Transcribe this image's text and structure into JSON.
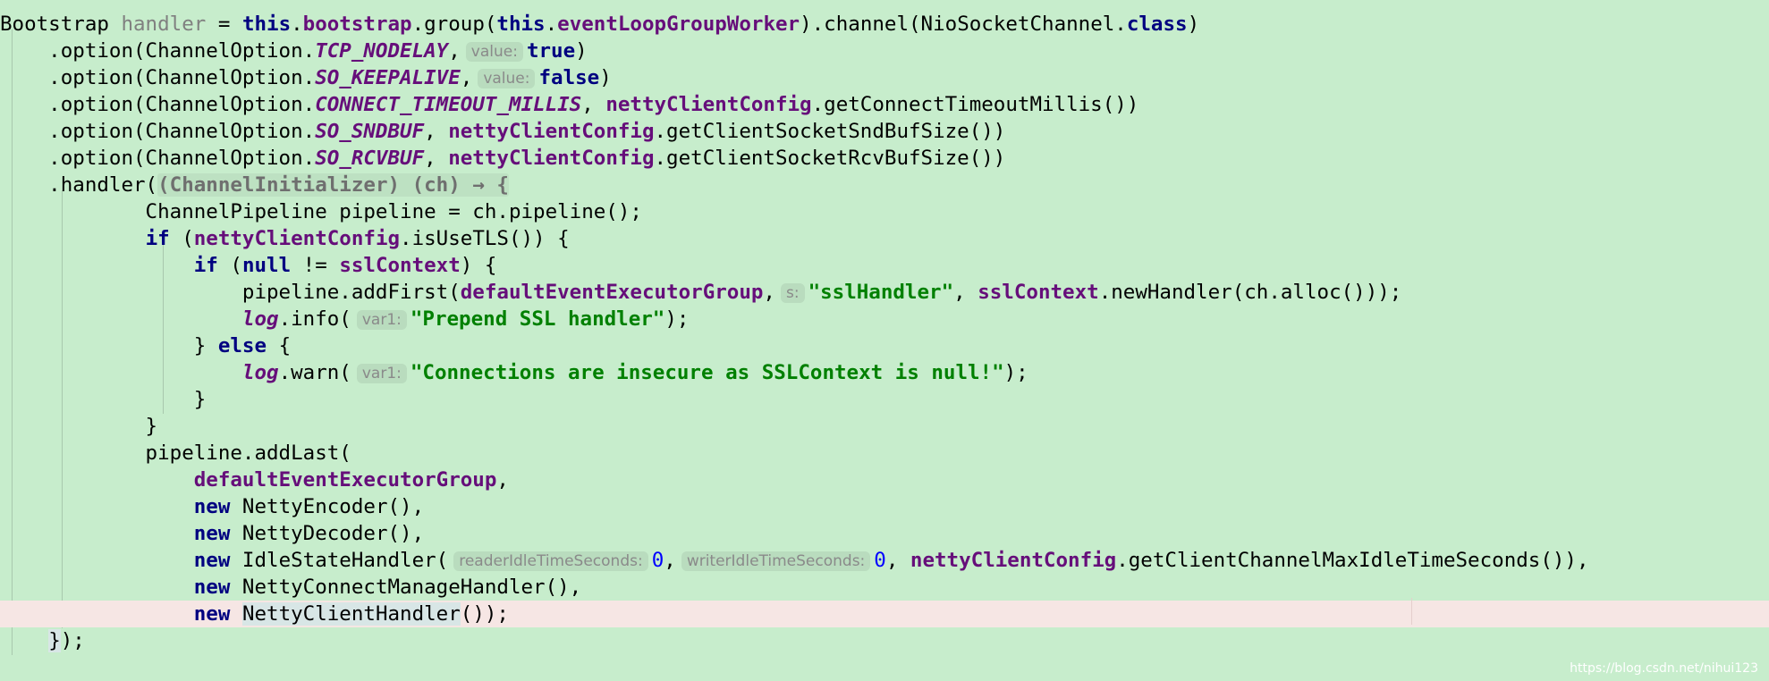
{
  "editor": {
    "theme": {
      "background": "#c7edcc",
      "highlight_line": "#f6e6e4",
      "keyword": "#000080",
      "field": "#660e7a",
      "string": "#008000",
      "number": "#0000ff",
      "hint": "#8a8a8a"
    },
    "code": {
      "l1": {
        "type": "Bootstrap ",
        "var": "handler",
        "assign": " = ",
        "this1": "this",
        "dot1": ".",
        "bootstrap": "bootstrap",
        "group_open": ".group(",
        "this2": "this",
        "dot2": ".",
        "worker": "eventLoopGroupWorker",
        "channel_call": ").channel(NioSocketChannel.",
        "class_kw": "class",
        "close": ")"
      },
      "l2": {
        "prefix": "    .option(ChannelOption.",
        "const": "TCP_NODELAY",
        "comma": ",",
        "hint": "value:",
        "value": "true",
        "close": ")"
      },
      "l3": {
        "prefix": "    .option(ChannelOption.",
        "const": "SO_KEEPALIVE",
        "comma": ",",
        "hint": "value:",
        "value": "false",
        "close": ")"
      },
      "l4": {
        "prefix": "    .option(ChannelOption.",
        "const": "CONNECT_TIMEOUT_MILLIS",
        "comma": ", ",
        "config": "nettyClientConfig",
        "call": ".getConnectTimeoutMillis())"
      },
      "l5": {
        "prefix": "    .option(ChannelOption.",
        "const": "SO_SNDBUF",
        "comma": ", ",
        "config": "nettyClientConfig",
        "call": ".getClientSocketSndBufSize())"
      },
      "l6": {
        "prefix": "    .option(ChannelOption.",
        "const": "SO_RCVBUF",
        "comma": ", ",
        "config": "nettyClientConfig",
        "call": ".getClientSocketRcvBufSize())"
      },
      "l7": {
        "prefix": "    .handler(",
        "lambda": "(ChannelInitializer) (ch) → {"
      },
      "l8": {
        "text": "            ChannelPipeline pipeline = ch.pipeline();"
      },
      "l9": {
        "indent": "            ",
        "if_kw": "if",
        "open": " (",
        "config": "nettyClientConfig",
        "rest": ".isUseTLS()) {"
      },
      "l10": {
        "indent": "                ",
        "if_kw": "if",
        "open": " (",
        "null_kw": "null",
        "neq": " != ",
        "ssl": "sslContext",
        "rest": ") {"
      },
      "l11": {
        "prefix": "                    pipeline.addFirst(",
        "group": "defaultEventExecutorGroup",
        "comma": ",",
        "hint": "s:",
        "str": "\"sslHandler\"",
        "comma2": ", ",
        "ssl": "sslContext",
        "rest": ".newHandler(ch.alloc()));"
      },
      "l12": {
        "indent": "                    ",
        "log": "log",
        "call": ".info(",
        "hint": "var1:",
        "str": "\"Prepend SSL handler\"",
        "close": ");"
      },
      "l13": {
        "prefix": "                } ",
        "else_kw": "else",
        "rest": " {"
      },
      "l14": {
        "indent": "                    ",
        "log": "log",
        "call": ".warn(",
        "hint": "var1:",
        "str": "\"Connections are insecure as SSLContext is null!\"",
        "close": ");"
      },
      "l15": {
        "text": "                }"
      },
      "l16": {
        "text": "            }"
      },
      "l17": {
        "text": "            pipeline.addLast("
      },
      "l18": {
        "indent": "                ",
        "group": "defaultEventExecutorGroup",
        "comma": ","
      },
      "l19": {
        "indent": "                ",
        "new_kw": "new",
        "rest": " NettyEncoder(),"
      },
      "l20": {
        "indent": "                ",
        "new_kw": "new",
        "rest": " NettyDecoder(),"
      },
      "l21": {
        "indent": "                ",
        "new_kw": "new",
        "call": " IdleStateHandler(",
        "hint1": "readerIdleTimeSeconds:",
        "num1": "0",
        "comma1": ",",
        "hint2": "writerIdleTimeSeconds:",
        "num2": "0",
        "comma2": ", ",
        "config": "nettyClientConfig",
        "rest": ".getClientChannelMaxIdleTimeSeconds()),"
      },
      "l22": {
        "indent": "                ",
        "new_kw": "new",
        "rest": " NettyConnectManageHandler(),"
      },
      "l23": {
        "indent": "                ",
        "new_kw": "new",
        "space": " ",
        "cls": "NettyClientHandler",
        "rest": "());"
      },
      "l24": {
        "indent": "    ",
        "brace": "}",
        "rest": ");"
      }
    }
  },
  "watermark": "https://blog.csdn.net/nihui123"
}
